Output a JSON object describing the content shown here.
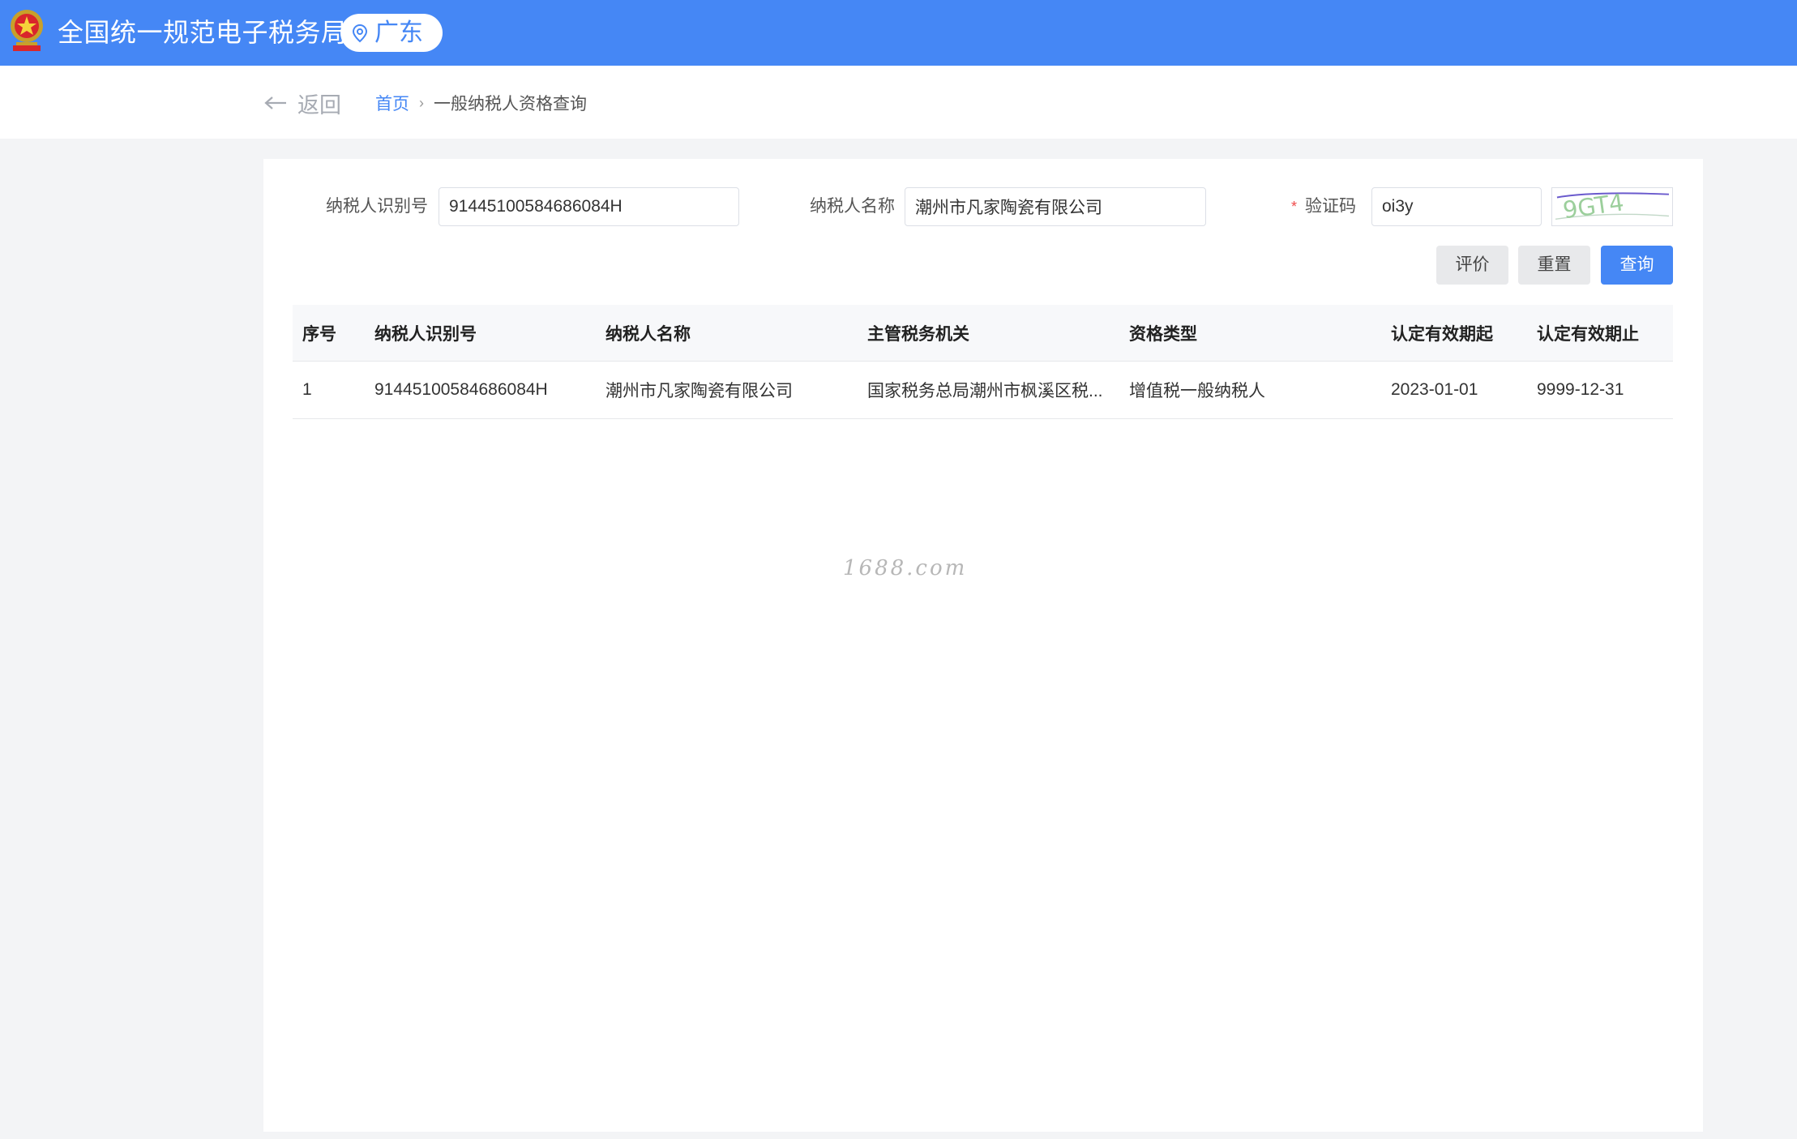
{
  "header": {
    "site_title": "全国统一规范电子税务局",
    "region": "广东",
    "brand_color": "#4587f5"
  },
  "breadcrumb": {
    "back_label": "返回",
    "home": "首页",
    "current": "一般纳税人资格查询"
  },
  "form": {
    "taxpayer_id_label": "纳税人识别号",
    "taxpayer_id_value": "91445100584686084H",
    "taxpayer_name_label": "纳税人名称",
    "taxpayer_name_value": "潮州市凡家陶瓷有限公司",
    "captcha_label": "验证码",
    "captcha_value": "oi3y",
    "captcha_image_text": "9GT4"
  },
  "buttons": {
    "evaluate": "评价",
    "reset": "重置",
    "query": "查询"
  },
  "table": {
    "columns": [
      "序号",
      "纳税人识别号",
      "纳税人名称",
      "主管税务机关",
      "资格类型",
      "认定有效期起",
      "认定有效期止"
    ],
    "rows": [
      [
        "1",
        "91445100584686084H",
        "潮州市凡家陶瓷有限公司",
        "国家税务总局潮州市枫溪区税...",
        "增值税一般纳税人",
        "2023-01-01",
        "9999-12-31"
      ]
    ]
  },
  "watermark": "1688.com"
}
